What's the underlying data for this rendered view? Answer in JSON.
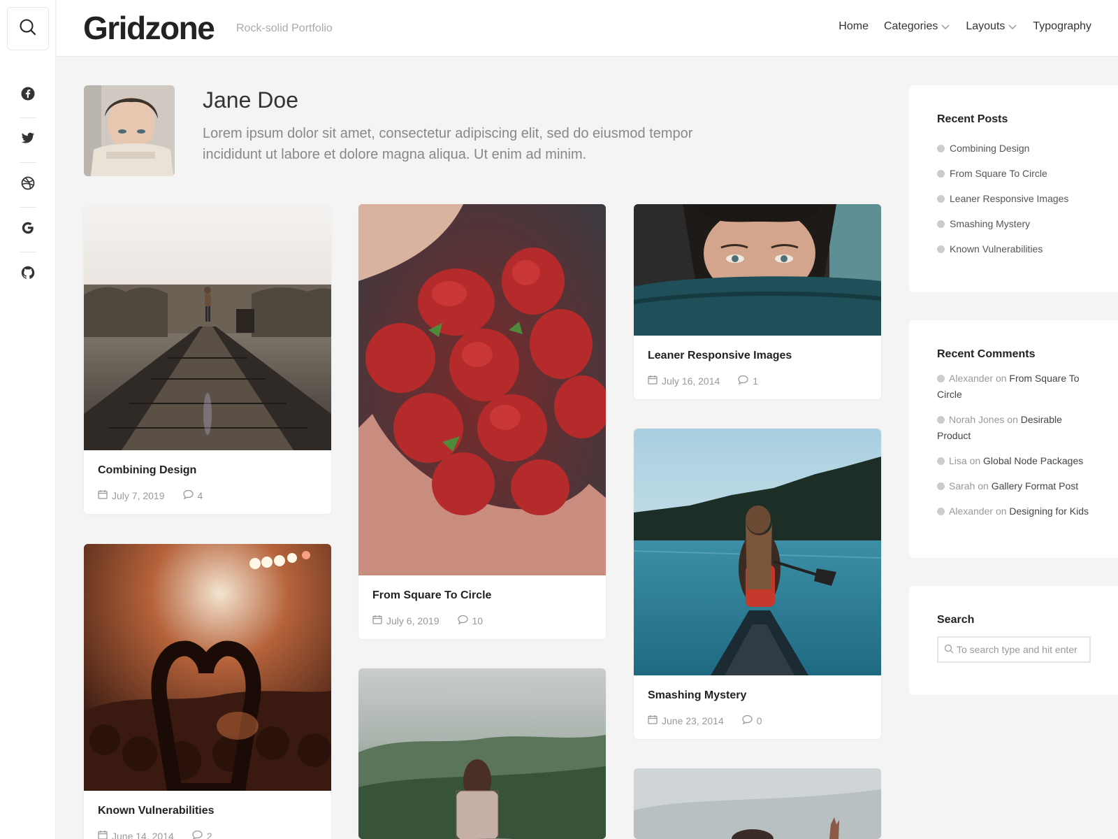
{
  "site": {
    "logo": "Gridzone",
    "tagline": "Rock-solid Portfolio"
  },
  "nav": {
    "home": "Home",
    "categories": "Categories",
    "layouts": "Layouts",
    "typography": "Typography"
  },
  "socials": [
    "facebook-icon",
    "twitter-icon",
    "dribbble-icon",
    "google-icon",
    "github-icon"
  ],
  "author": {
    "name": "Jane Doe",
    "bio": "Lorem ipsum dolor sit amet, consectetur adipiscing elit, sed do eiusmod tempor incididunt ut labore et dolore magna aliqua. Ut enim ad minim."
  },
  "posts": [
    {
      "title": "Combining Design",
      "date": "July 7, 2019",
      "comments": "4"
    },
    {
      "title": "From Square To Circle",
      "date": "July 6, 2019",
      "comments": "10"
    },
    {
      "title": "Leaner Responsive Images",
      "date": "July 16, 2014",
      "comments": "1"
    },
    {
      "title": "Smashing Mystery",
      "date": "June 23, 2014",
      "comments": "0"
    },
    {
      "title": "Known Vulnerabilities",
      "date": "June 14, 2014",
      "comments": "2"
    }
  ],
  "recent_posts": {
    "heading": "Recent Posts",
    "items": [
      "Combining Design",
      "From Square To Circle",
      "Leaner Responsive Images",
      "Smashing Mystery",
      "Known Vulnerabilities"
    ]
  },
  "recent_comments": {
    "heading": "Recent Comments",
    "on": "on",
    "items": [
      {
        "author": "Alexander",
        "post": "From Square To Circle"
      },
      {
        "author": "Norah Jones",
        "post": "Desirable Product"
      },
      {
        "author": "Lisa",
        "post": "Global Node Packages"
      },
      {
        "author": "Sarah",
        "post": "Gallery Format Post"
      },
      {
        "author": "Alexander",
        "post": "Designing for Kids"
      }
    ]
  },
  "search_widget": {
    "heading": "Search",
    "placeholder": "To search type and hit enter"
  }
}
